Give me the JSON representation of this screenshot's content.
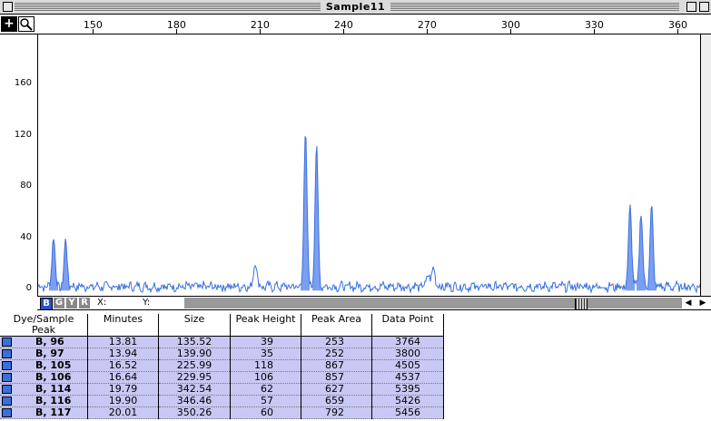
{
  "window": {
    "title": "Sample11"
  },
  "ruler": {
    "ticks": [
      "150",
      "180",
      "210",
      "240",
      "270",
      "300",
      "330",
      "360"
    ],
    "tick_values": [
      150,
      180,
      210,
      240,
      270,
      300,
      330,
      360
    ]
  },
  "yaxis": {
    "labels": [
      "160",
      "120",
      "80",
      "40",
      "0"
    ]
  },
  "dyes": [
    "B",
    "G",
    "Y",
    "R"
  ],
  "readout": {
    "x_label": "X:",
    "y_label": "Y:"
  },
  "colors": {
    "trace": "#3b6fe0",
    "peak_fill": "#7b9ff0",
    "table_row": "#c8c8f4"
  },
  "table": {
    "headers": [
      "Dye/Sample\nPeak",
      "Minutes",
      "Size",
      "Peak Height",
      "Peak Area",
      "Data Point"
    ],
    "rows": [
      [
        "B, 96",
        "13.81",
        "135.52",
        "39",
        "253",
        "3764"
      ],
      [
        "B, 97",
        "13.94",
        "139.90",
        "35",
        "252",
        "3800"
      ],
      [
        "B, 105",
        "16.52",
        "225.99",
        "118",
        "867",
        "4505"
      ],
      [
        "B, 106",
        "16.64",
        "229.95",
        "106",
        "857",
        "4537"
      ],
      [
        "B, 114",
        "19.79",
        "342.54",
        "62",
        "627",
        "5395"
      ],
      [
        "B, 116",
        "19.90",
        "346.46",
        "57",
        "659",
        "5426"
      ],
      [
        "B, 117",
        "20.01",
        "350.26",
        "60",
        "792",
        "5456"
      ]
    ]
  },
  "chart_data": {
    "type": "line",
    "xlim": [
      130,
      368
    ],
    "ylim": [
      -4,
      195
    ],
    "peaks": [
      {
        "size": 135.52,
        "height": 39
      },
      {
        "size": 139.9,
        "height": 35
      },
      {
        "size": 225.99,
        "height": 118
      },
      {
        "size": 229.95,
        "height": 106
      },
      {
        "size": 342.54,
        "height": 62
      },
      {
        "size": 346.46,
        "height": 57
      },
      {
        "size": 350.26,
        "height": 60
      }
    ],
    "minor_peaks": [
      {
        "size": 208,
        "height": 20
      },
      {
        "size": 272,
        "height": 15
      },
      {
        "size": 270,
        "height": 10
      }
    ],
    "yticks": [
      0,
      40,
      80,
      120,
      160
    ]
  }
}
